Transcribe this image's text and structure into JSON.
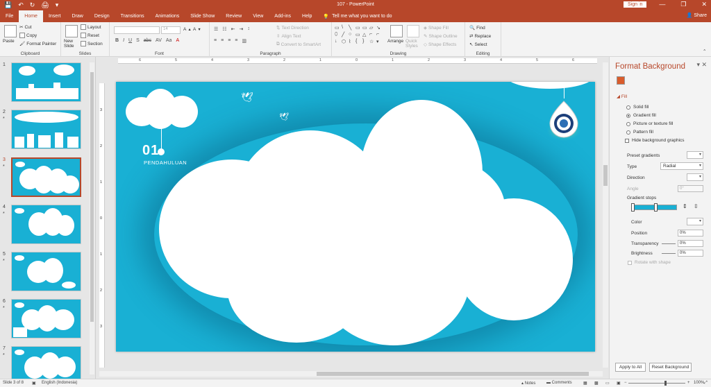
{
  "titlebar": {
    "doc_title": "107 - PowerPoint",
    "sign_in": "Sign in",
    "share": "Share",
    "qat": [
      "💾",
      "↶",
      "↻",
      "🖨",
      "▾"
    ],
    "win_controls": [
      "⊡",
      "—",
      "❐",
      "✕"
    ]
  },
  "tabs": [
    "File",
    "Home",
    "Insert",
    "Draw",
    "Design",
    "Transitions",
    "Animations",
    "Slide Show",
    "Review",
    "View",
    "Add-ins",
    "Help"
  ],
  "active_tab": "Home",
  "tell_me": "Tell me what you want to do",
  "ribbon": {
    "clipboard": {
      "label": "Clipboard",
      "paste": "Paste",
      "cut": "Cut",
      "copy": "Copy",
      "format_painter": "Format Painter"
    },
    "slides": {
      "label": "Slides",
      "new_slide": "New\nSlide",
      "layout": "Layout",
      "reset": "Reset",
      "section": "Section"
    },
    "font": {
      "label": "Font",
      "size": "14",
      "buttons": [
        "B",
        "I",
        "U",
        "S",
        "abc",
        "AV",
        "Aa",
        "A"
      ]
    },
    "paragraph": {
      "label": "Paragraph",
      "text_direction": "Text Direction",
      "align_text": "Align Text",
      "convert_smartart": "Convert to SmartArt"
    },
    "drawing": {
      "label": "Drawing",
      "arrange": "Arrange",
      "quick_styles": "Quick\nStyles",
      "shape_fill": "Shape Fill",
      "shape_outline": "Shape Outline",
      "shape_effects": "Shape Effects",
      "shapes": [
        "▭",
        "\\",
        "╲",
        "▭",
        "▭",
        "▱",
        "↘",
        "⬯",
        "╱",
        "○",
        "▭",
        "△",
        "⌐",
        "⌐",
        "↓",
        "⬡",
        "⌇",
        "{",
        "}",
        "☆",
        "▾"
      ]
    },
    "editing": {
      "label": "Editing",
      "find": "Find",
      "replace": "Replace",
      "select": "Select"
    }
  },
  "thumbnails": [
    {
      "num": "1",
      "star": ""
    },
    {
      "num": "2",
      "star": "*"
    },
    {
      "num": "3",
      "star": "*"
    },
    {
      "num": "4",
      "star": "*"
    },
    {
      "num": "5",
      "star": "*"
    },
    {
      "num": "6",
      "star": "*"
    },
    {
      "num": "7",
      "star": "*"
    }
  ],
  "selected_slide": 3,
  "ruler": {
    "h_ticks": [
      "6",
      "5",
      "4",
      "3",
      "2",
      "1",
      "0",
      "1",
      "2",
      "3",
      "4",
      "5",
      "6"
    ],
    "v_ticks": [
      "3",
      "2",
      "1",
      "0",
      "1",
      "2",
      "3"
    ]
  },
  "slide": {
    "section_number": "01",
    "section_title": "PENDAHULUAN",
    "background": "#19b0d4"
  },
  "format_pane": {
    "title": "Format Background",
    "fill_label": "Fill",
    "options": [
      "Solid fill",
      "Gradient fill",
      "Picture or texture fill",
      "Pattern fill"
    ],
    "selected_option": "Gradient fill",
    "hide_bg": "Hide background graphics",
    "preset_gradients": "Preset gradients",
    "type_label": "Type",
    "type_value": "Radial",
    "direction": "Direction",
    "angle": "Angle",
    "angle_value": "0°",
    "gradient_stops": "Gradient stops",
    "color": "Color",
    "position": "Position",
    "position_value": "0%",
    "transparency": "Transparency",
    "transparency_value": "0%",
    "brightness": "Brightness",
    "brightness_value": "0%",
    "rotate": "Rotate with shape",
    "apply_all": "Apply to All",
    "reset_bg": "Reset Background"
  },
  "status": {
    "slide_of": "Slide 3 of 8",
    "language": "English (Indonesia)",
    "notes": "Notes",
    "comments": "Comments",
    "zoom": "100%"
  },
  "colors": {
    "accent": "#b7472a",
    "slide_bg": "#19b0d4"
  }
}
